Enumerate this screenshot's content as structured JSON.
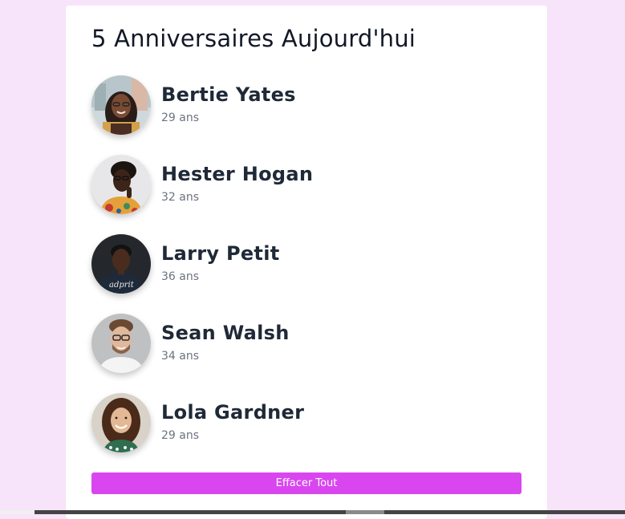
{
  "title": "5 Anniversaires Aujourd'hui",
  "people": [
    {
      "name": "Bertie Yates",
      "age": "29 ans"
    },
    {
      "name": "Hester Hogan",
      "age": "32 ans"
    },
    {
      "name": "Larry Petit",
      "age": "36 ans"
    },
    {
      "name": "Sean Walsh",
      "age": "34 ans"
    },
    {
      "name": "Lola Gardner",
      "age": "29 ans"
    }
  ],
  "clear_button": "Effacer Tout",
  "colors": {
    "background": "#f8e4fa",
    "card": "#ffffff",
    "accent": "#d946ef",
    "name_text": "#1f2937",
    "age_text": "#6b7280"
  }
}
